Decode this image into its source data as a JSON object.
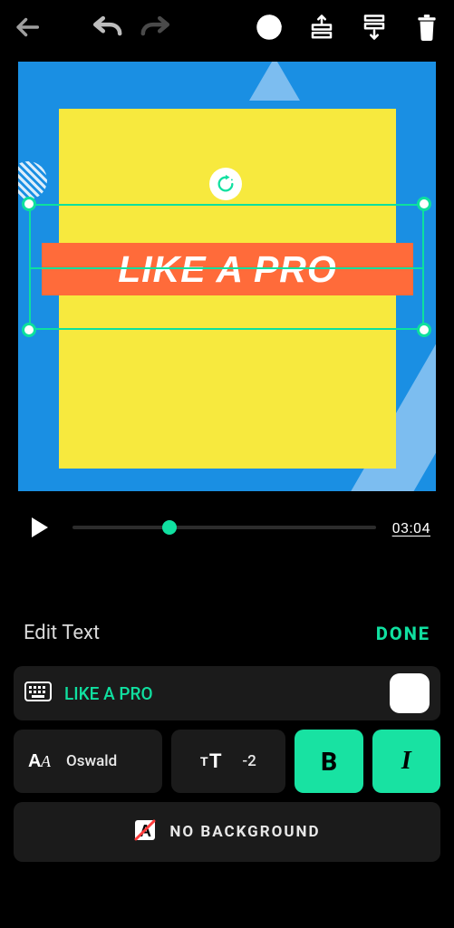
{
  "canvas": {
    "hero_text": "LIKE A PRO"
  },
  "playback": {
    "time_label": "03:04"
  },
  "panel": {
    "title": "Edit Text",
    "done": "DONE"
  },
  "text_input": {
    "value": "LIKE A PRO"
  },
  "font": {
    "name": "Oswald"
  },
  "size": {
    "value": "-2"
  },
  "style_buttons": {
    "bold": "B",
    "italic": "I"
  },
  "background": {
    "label": "NO BACKGROUND"
  }
}
